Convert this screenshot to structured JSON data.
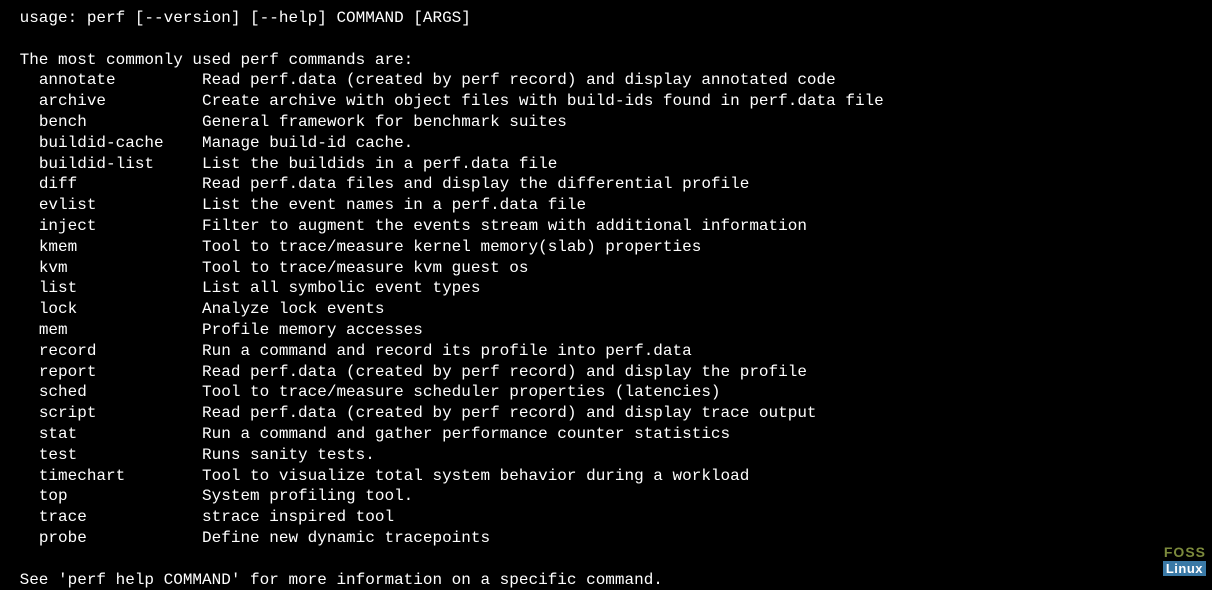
{
  "usage": " usage: perf [--version] [--help] COMMAND [ARGS]",
  "heading": " The most commonly used perf commands are:",
  "indent": "   ",
  "commands": [
    {
      "name": "annotate",
      "desc": "Read perf.data (created by perf record) and display annotated code"
    },
    {
      "name": "archive",
      "desc": "Create archive with object files with build-ids found in perf.data file"
    },
    {
      "name": "bench",
      "desc": "General framework for benchmark suites"
    },
    {
      "name": "buildid-cache",
      "desc": "Manage build-id cache."
    },
    {
      "name": "buildid-list",
      "desc": "List the buildids in a perf.data file"
    },
    {
      "name": "diff",
      "desc": "Read perf.data files and display the differential profile"
    },
    {
      "name": "evlist",
      "desc": "List the event names in a perf.data file"
    },
    {
      "name": "inject",
      "desc": "Filter to augment the events stream with additional information"
    },
    {
      "name": "kmem",
      "desc": "Tool to trace/measure kernel memory(slab) properties"
    },
    {
      "name": "kvm",
      "desc": "Tool to trace/measure kvm guest os"
    },
    {
      "name": "list",
      "desc": "List all symbolic event types"
    },
    {
      "name": "lock",
      "desc": "Analyze lock events"
    },
    {
      "name": "mem",
      "desc": "Profile memory accesses"
    },
    {
      "name": "record",
      "desc": "Run a command and record its profile into perf.data"
    },
    {
      "name": "report",
      "desc": "Read perf.data (created by perf record) and display the profile"
    },
    {
      "name": "sched",
      "desc": "Tool to trace/measure scheduler properties (latencies)"
    },
    {
      "name": "script",
      "desc": "Read perf.data (created by perf record) and display trace output"
    },
    {
      "name": "stat",
      "desc": "Run a command and gather performance counter statistics"
    },
    {
      "name": "test",
      "desc": "Runs sanity tests."
    },
    {
      "name": "timechart",
      "desc": "Tool to visualize total system behavior during a workload"
    },
    {
      "name": "top",
      "desc": "System profiling tool."
    },
    {
      "name": "trace",
      "desc": "strace inspired tool"
    },
    {
      "name": "probe",
      "desc": "Define new dynamic tracepoints"
    }
  ],
  "footer": " See 'perf help COMMAND' for more information on a specific command.",
  "logo": {
    "top": "FOSS",
    "bottom": "Linux"
  }
}
